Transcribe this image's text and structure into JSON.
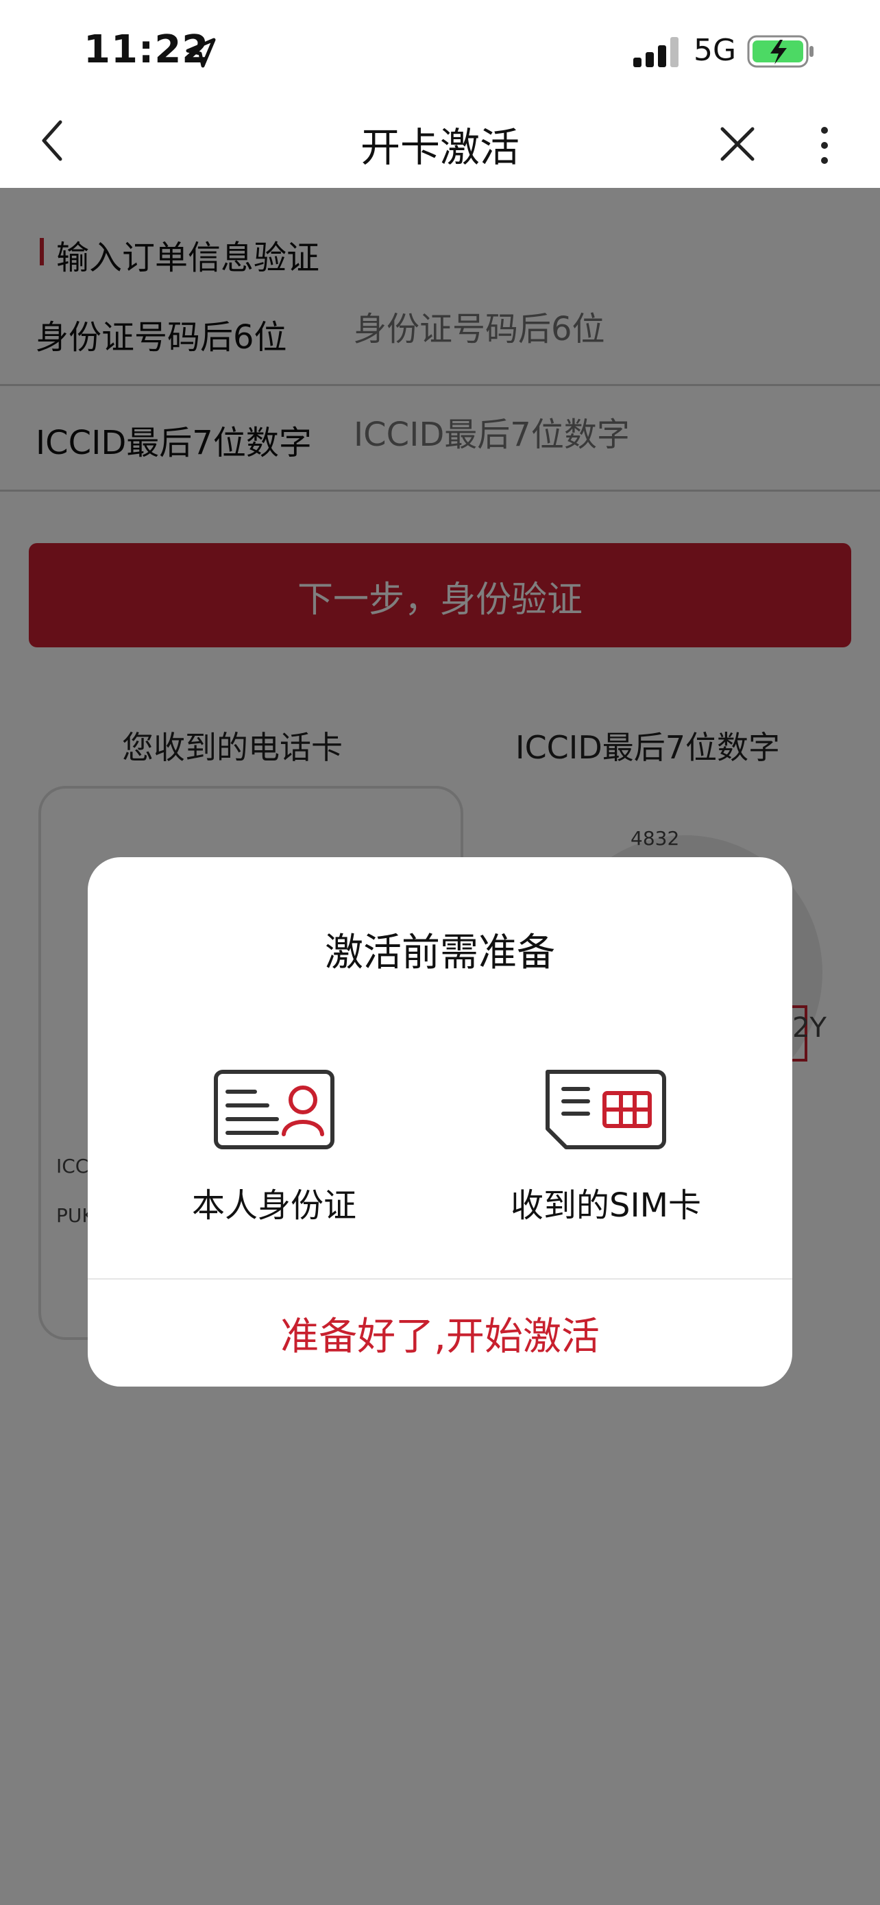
{
  "status_bar": {
    "time": "11:22",
    "network": "5G"
  },
  "nav": {
    "title": "开卡激活"
  },
  "form": {
    "section_title": "输入订单信息验证",
    "id_label": "身份证号码后6位",
    "id_placeholder": "身份证号码后6位",
    "iccid_label": "ICCID最后7位数字",
    "iccid_placeholder": "ICCID最后7位数字",
    "next_button": "下一步，身份验证"
  },
  "reference": {
    "card_title": "您收到的电话卡",
    "iccid_title": "ICCID最后7位数字",
    "card_line1": "ICC",
    "card_line2": "PUK",
    "sim_partial_top": "4832",
    "sim_partial_right": "2Y"
  },
  "modal": {
    "title": "激活前需准备",
    "items": [
      {
        "label": "本人身份证",
        "icon": "id-card-icon"
      },
      {
        "label": "收到的SIM卡",
        "icon": "sim-card-icon"
      }
    ],
    "action": "准备好了,开始激活"
  },
  "colors": {
    "accent": "#c8202e",
    "overlay": "rgba(0,0,0,0.5)"
  }
}
